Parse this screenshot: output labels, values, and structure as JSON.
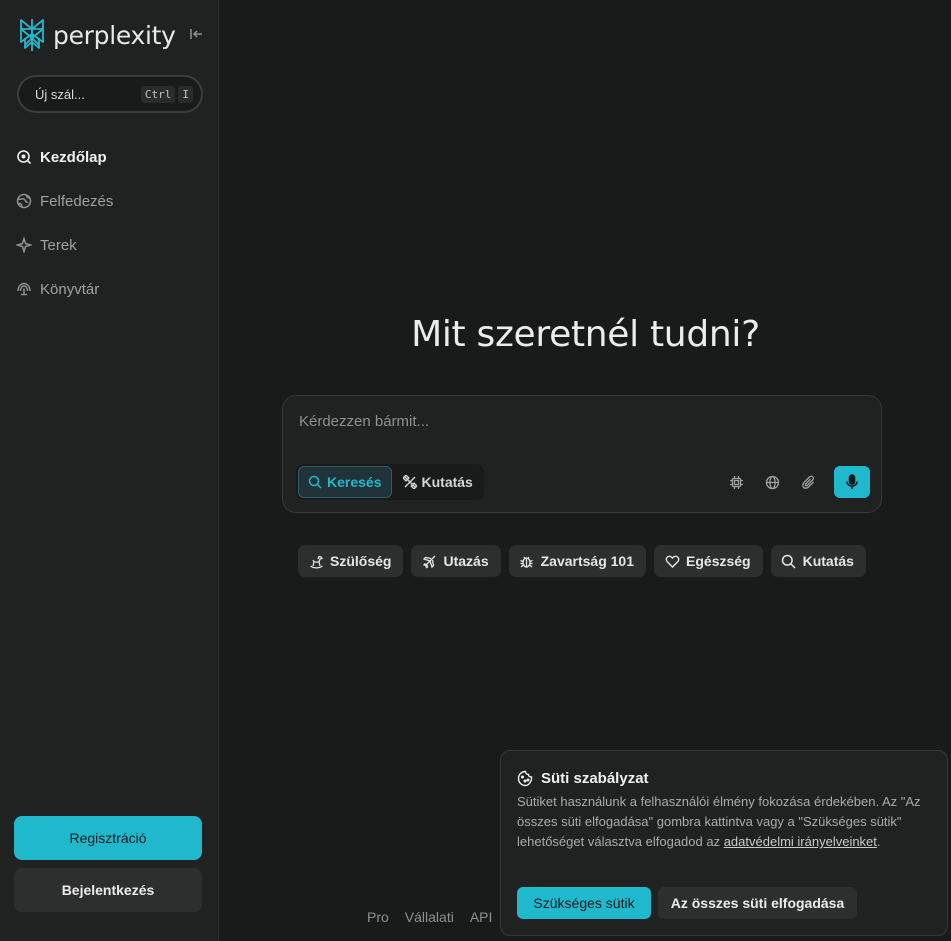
{
  "sidebar": {
    "brand": "perplexity",
    "new_thread": {
      "label": "Új szál...",
      "shortcut_keys": [
        "Ctrl",
        "I"
      ]
    },
    "nav_items": [
      {
        "label": "Kezdőlap",
        "icon": "search-icon",
        "active": true
      },
      {
        "label": "Felfedezés",
        "icon": "globe-icon",
        "active": false
      },
      {
        "label": "Terek",
        "icon": "sparkle-icon",
        "active": false
      },
      {
        "label": "Könyvtár",
        "icon": "library-icon",
        "active": false
      }
    ],
    "register_label": "Regisztráció",
    "login_label": "Bejelentkezés"
  },
  "main": {
    "headline": "Mit szeretnél tudni?",
    "search": {
      "placeholder": "Kérdezzen bármit...",
      "modes": [
        {
          "label": "Keresés",
          "icon": "search-icon",
          "active": true
        },
        {
          "label": "Kutatás",
          "icon": "research-icon",
          "active": false
        }
      ],
      "tools": [
        "model-chip-icon",
        "globe-icon",
        "paperclip-icon",
        "microphone-icon"
      ]
    },
    "suggestions": [
      {
        "label": "Szülőség",
        "icon": "rocking-horse-icon"
      },
      {
        "label": "Utazás",
        "icon": "plane-icon"
      },
      {
        "label": "Zavartság 101",
        "icon": "bug-icon"
      },
      {
        "label": "Egészség",
        "icon": "heart-icon"
      },
      {
        "label": "Kutatás",
        "icon": "search-icon"
      }
    ],
    "footer_links": [
      "Pro",
      "Vállalati",
      "API"
    ]
  },
  "cookie_banner": {
    "title": "Süti szabályzat",
    "text": "Sütiket használunk a felhasználói élmény fokozása érdekében. Az \"Az összes süti elfogadása\" gombra kattintva vagy a \"Szükséges sütik\" lehetőséget választva elfogadod az ",
    "link_text": "adatvédelmi irányelveinket",
    "text_end": ".",
    "necessary_label": "Szükséges sütik",
    "accept_all_label": "Az összes süti elfogadása"
  },
  "colors": {
    "accent": "#20b8cd",
    "background": "#191a1a",
    "sidebar": "#202222"
  }
}
